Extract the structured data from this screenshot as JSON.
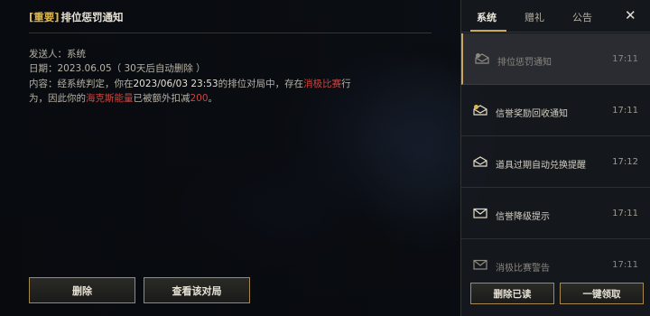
{
  "message": {
    "tag": "[重要]",
    "title": "排位惩罚通知",
    "sender_label": "发送人：",
    "sender": "系统",
    "date_label": "日期：",
    "date": "2023.06.05（ 30天后自动删除 ）",
    "body_1": "内容：经系统判定，你在",
    "body_time": "2023/06/03 23:53",
    "body_2": "的排位对局中，存在",
    "body_red1": "消极比赛",
    "body_3": "行为，因此你的",
    "body_red2": "海克斯能量",
    "body_4": "已被额外扣减",
    "body_red3": "200",
    "body_5": "。",
    "delete_label": "删除",
    "view_match_label": "查看该对局"
  },
  "sidebar": {
    "tabs": {
      "system": "系统",
      "gift": "赠礼",
      "notice": "公告"
    },
    "close_label": "✕",
    "items": [
      {
        "label": "排位惩罚通知",
        "time": "17:11",
        "icon": "mail-open-alert-icon"
      },
      {
        "label": "信誉奖励回收通知",
        "time": "17:11",
        "icon": "mail-open-alert-icon"
      },
      {
        "label": "道具过期自动兑换提醒",
        "time": "17:12",
        "icon": "mail-open-icon"
      },
      {
        "label": "信誉降级提示",
        "time": "17:11",
        "icon": "mail-icon"
      },
      {
        "label": "消极比赛警告",
        "time": "17:11",
        "icon": "mail-icon"
      }
    ],
    "delete_read_label": "删除已读",
    "claim_all_label": "一键领取"
  },
  "colors": {
    "accent_gold": "#c9a760",
    "alert_red": "#c9453f",
    "tag_yellow": "#e0b84a"
  }
}
